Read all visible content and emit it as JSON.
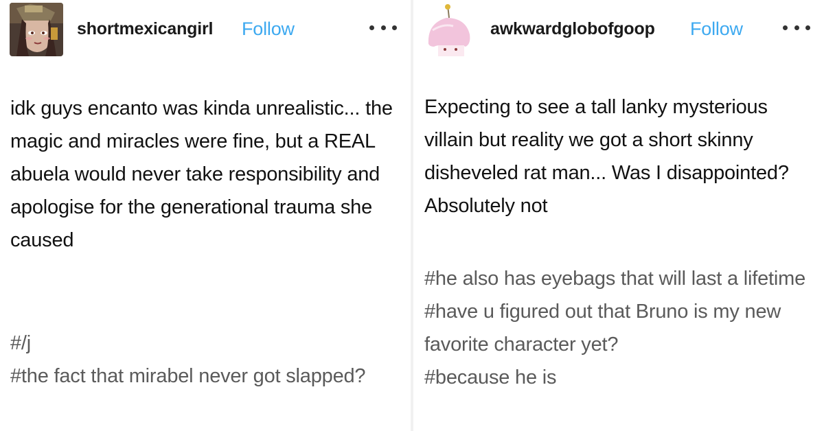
{
  "posts": [
    {
      "username": "shortmexicangirl",
      "follow_label": "Follow",
      "avatar": "anime-character-avatar",
      "more_icon": "ellipsis-icon",
      "body": "idk guys encanto was kinda unrealistic... the magic and miracles were fine, but a REAL abuela would never take responsibility and apologise for the generational trauma she caused",
      "tags": [
        "#/j",
        "#the fact that mirabel never got slapped?"
      ]
    },
    {
      "username": "awkwardglobofgoop",
      "follow_label": "Follow",
      "avatar": "pink-blob-creature-avatar",
      "more_icon": "ellipsis-icon",
      "body": "Expecting to see a tall lanky mysterious villain but reality we got a short skinny disheveled rat man... Was I disappointed? Absolutely not",
      "tags": [
        "#he also has eyebags that will last a lifetime",
        "#have u figured out that Bruno is my new favorite character yet?",
        "#because he is"
      ]
    }
  ],
  "colors": {
    "follow": "#3da9f0",
    "tag_text": "#5a5a5a",
    "body_text": "#111111"
  }
}
